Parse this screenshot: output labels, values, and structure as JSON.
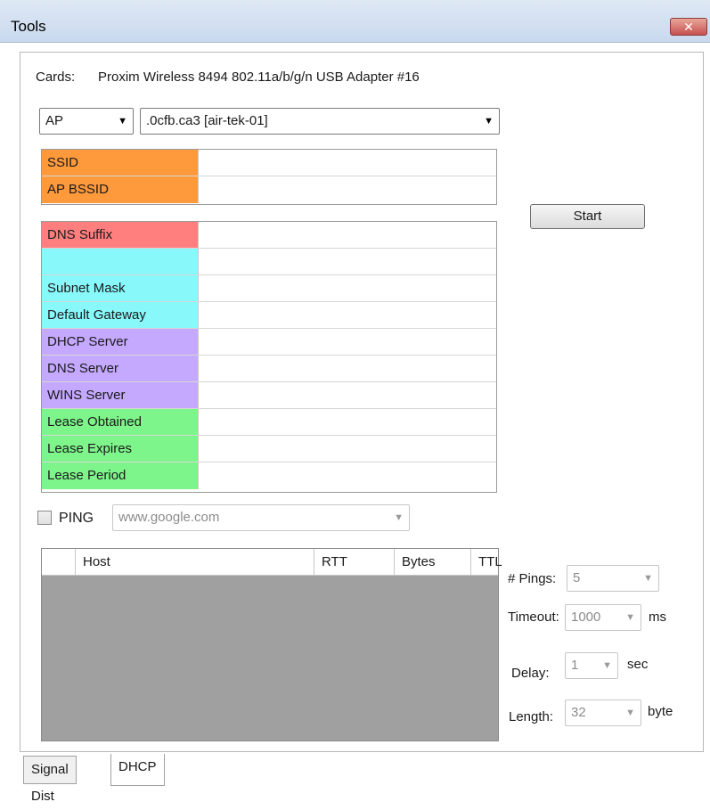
{
  "window": {
    "title": "Tools",
    "close_glyph": "✕"
  },
  "cards": {
    "label": "Cards:",
    "value": "Proxim Wireless 8494 802.11a/b/g/n USB Adapter #16"
  },
  "mode_select": {
    "value": "AP"
  },
  "ap_select": {
    "value": ".0cfb.ca3 [air-tek-01]"
  },
  "ap_fields": [
    {
      "label": "SSID",
      "value": ""
    },
    {
      "label": "AP BSSID",
      "value": ""
    }
  ],
  "start_button": {
    "label": "Start"
  },
  "dhcp_fields": [
    {
      "label": "DNS Suffix",
      "value": ""
    },
    {
      "label": "",
      "value": ""
    },
    {
      "label": "Subnet Mask",
      "value": ""
    },
    {
      "label": "Default Gateway",
      "value": ""
    },
    {
      "label": "DHCP Server",
      "value": ""
    },
    {
      "label": "DNS Server",
      "value": ""
    },
    {
      "label": "WINS Server",
      "value": ""
    },
    {
      "label": "Lease Obtained",
      "value": ""
    },
    {
      "label": "Lease Expires",
      "value": ""
    },
    {
      "label": "Lease Period",
      "value": ""
    }
  ],
  "ping": {
    "checkbox_label": "PING",
    "checked": false,
    "host_value": "www.google.com",
    "columns": [
      "",
      "Host",
      "RTT",
      "Bytes",
      "TTL"
    ],
    "options": {
      "pings_label": "# Pings:",
      "pings_value": "5",
      "timeout_label": "Timeout:",
      "timeout_value": "1000",
      "timeout_unit": "ms",
      "delay_label": "Delay:",
      "delay_value": "1",
      "delay_unit": "sec",
      "length_label": "Length:",
      "length_value": "32",
      "length_unit": "byte"
    }
  },
  "tabs": [
    {
      "label": "Signal Dist",
      "active": false
    },
    {
      "label": "DHCP",
      "active": true
    }
  ],
  "colors": {
    "ap_info": "#ff9a3c",
    "dns_suffix": "#ff7f7f",
    "ip": "#88f8fb",
    "servers": "#c5a8ff",
    "lease": "#7ef58a"
  }
}
